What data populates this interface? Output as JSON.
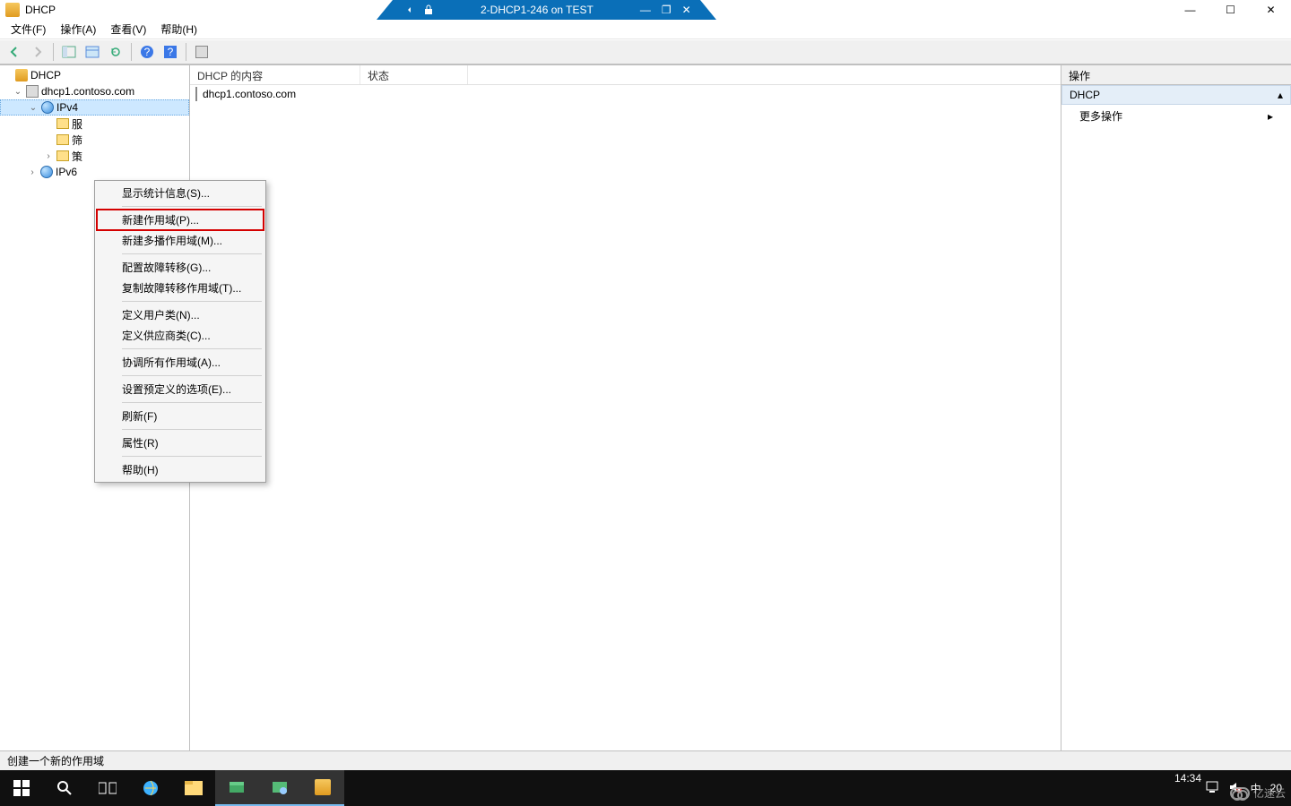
{
  "titlebar": {
    "app_title": "DHCP",
    "connection_label": "2-DHCP1-246 on TEST",
    "pin_icon": "pin-icon",
    "lock_icon": "lock-icon",
    "conn_min": "—",
    "conn_restore": "❐",
    "conn_close": "✕",
    "win_min": "—",
    "win_max": "☐",
    "win_close": "✕"
  },
  "menubar": {
    "file": "文件(F)",
    "action": "操作(A)",
    "view": "查看(V)",
    "help": "帮助(H)"
  },
  "toolbar": {
    "back": "←",
    "forward": "→",
    "up": "refresh",
    "properties": "props",
    "export": "export",
    "help": "?",
    "help2": "?",
    "extra": "server"
  },
  "tree": {
    "root": "DHCP",
    "server": "dhcp1.contoso.com",
    "ipv4": "IPv4",
    "child1": "服",
    "child2": "筛",
    "child3": "策",
    "ipv6": "IPv6"
  },
  "list": {
    "col1": "DHCP 的内容",
    "col2": "状态",
    "row1": "dhcp1.contoso.com"
  },
  "actions": {
    "header": "操作",
    "section": "DHCP",
    "more": "更多操作"
  },
  "context_menu": {
    "items": [
      "显示统计信息(S)...",
      "新建作用域(P)...",
      "新建多播作用域(M)...",
      "配置故障转移(G)...",
      "复制故障转移作用域(T)...",
      "定义用户类(N)...",
      "定义供应商类(C)...",
      "协调所有作用域(A)...",
      "设置预定义的选项(E)...",
      "刷新(F)",
      "属性(R)",
      "帮助(H)"
    ]
  },
  "statusbar": {
    "text": "创建一个新的作用域"
  },
  "taskbar": {
    "time": "14:34",
    "date_short": "20",
    "ime": "中",
    "watermark": "亿速云"
  }
}
